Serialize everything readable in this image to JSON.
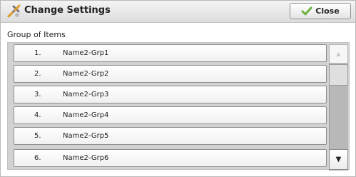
{
  "header": {
    "title": "Change Settings",
    "title_icon": "tools-icon",
    "close_label": "Close",
    "close_icon": "checkmark-icon"
  },
  "group_label": "Group of Items",
  "items": [
    {
      "number": "1.",
      "name": "Name2-Grp1"
    },
    {
      "number": "2.",
      "name": "Name2-Grp2"
    },
    {
      "number": "3.",
      "name": "Name2-Grp3"
    },
    {
      "number": "4.",
      "name": "Name2-Grp4"
    },
    {
      "number": "5.",
      "name": "Name2-Grp5"
    },
    {
      "number": "6.",
      "name": "Name2-Grp6"
    }
  ],
  "scroll": {
    "up_arrow": "▲",
    "down_arrow": "▼"
  },
  "colors": {
    "check_green": "#6cb33f",
    "tool_orange": "#e39b2b"
  }
}
